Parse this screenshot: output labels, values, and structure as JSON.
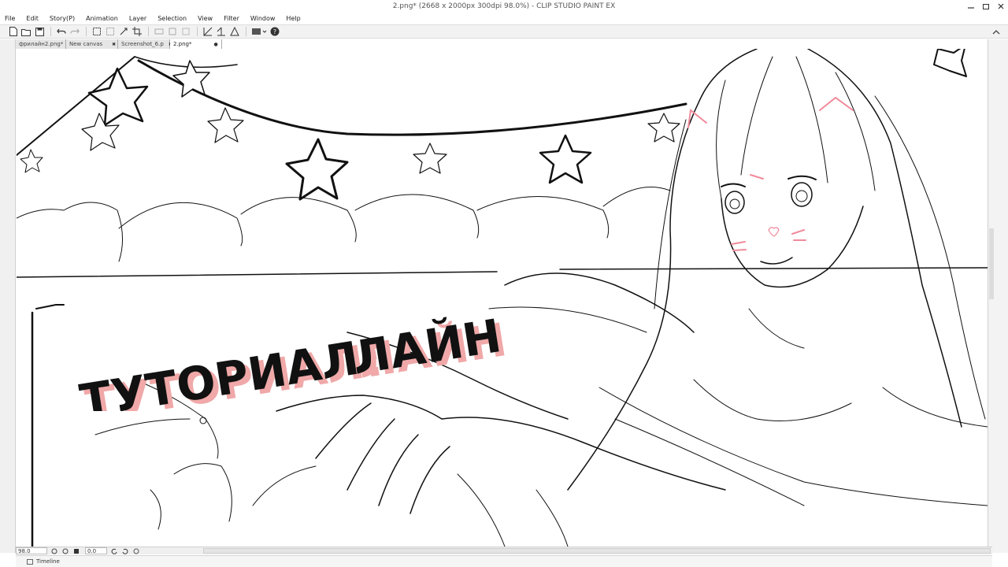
{
  "window": {
    "title": "2.png* (2668 x 2000px 300dpi 98.0%) - CLIP STUDIO PAINT EX"
  },
  "menu": {
    "items": [
      "File",
      "Edit",
      "Story(P)",
      "Animation",
      "Layer",
      "Selection",
      "View",
      "Filter",
      "Window",
      "Help"
    ]
  },
  "toolbar": {
    "icons": [
      "new-file-icon",
      "open-icon",
      "save-icon",
      "undo-icon",
      "redo-icon",
      "select-all-icon",
      "deselect-icon",
      "transform-icon",
      "crop-icon",
      "ruler-icon",
      "snap-icon",
      "perspective-icon",
      "symmetry-icon",
      "grid-icon",
      "view-mode-icon",
      "help-icon"
    ]
  },
  "tabs": [
    {
      "label": "фрилайн2.png*",
      "active": false
    },
    {
      "label": "New canvas",
      "active": false
    },
    {
      "label": "Screenshot_6.p",
      "active": false
    },
    {
      "label": "2.png*",
      "active": true
    }
  ],
  "status": {
    "zoom": "98.0",
    "angle": "0.0"
  },
  "timeline": {
    "label": "Timeline"
  },
  "overlay": {
    "line1": "ТУТОРИАЛ:",
    "line2": "ЛАЙН",
    "text_color": "#111111",
    "shadow_color": "#f0a8a8"
  },
  "colors": {
    "line_art": "#111111",
    "accent_pink": "#f08a9a"
  }
}
